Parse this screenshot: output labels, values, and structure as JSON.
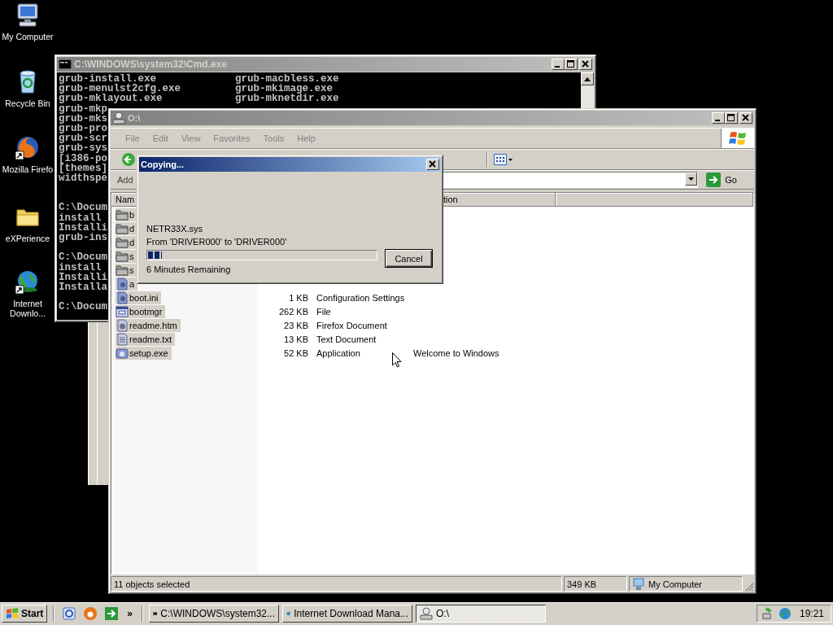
{
  "desktop_icons": [
    {
      "label": "My Computer",
      "kind": "computer",
      "shortcut": false
    },
    {
      "label": "Recycle Bin",
      "kind": "bin",
      "shortcut": false
    },
    {
      "label": "Mozilla Firefo",
      "kind": "browser",
      "shortcut": true
    },
    {
      "label": "eXPerience",
      "kind": "folder",
      "shortcut": false
    },
    {
      "label": "Internet Downlo...",
      "kind": "globe",
      "shortcut": true
    }
  ],
  "console_window": {
    "title": "C:\\WINDOWS\\system32\\Cmd.exe",
    "blocks": [
      [
        {
          "left": "grub-install.exe",
          "right": "grub-macbless.exe"
        },
        {
          "left": "grub-menulst2cfg.exe",
          "right": "grub-mkimage.exe"
        },
        {
          "left": "grub-mklayout.exe",
          "right": "grub-mknetdir.exe"
        },
        {
          "left": "grub-mkp"
        },
        {
          "left": "grub-mks"
        },
        {
          "left": "grub-pro"
        },
        {
          "left": "grub-scr"
        },
        {
          "left": "grub-sys"
        },
        {
          "left": "[i386-po"
        },
        {
          "left": "[themes]"
        },
        {
          "left": "widthspe"
        }
      ],
      [
        {
          "left": "C:\\Docum"
        },
        {
          "left": "install"
        },
        {
          "left": "Installi"
        },
        {
          "left": "grub-ins"
        }
      ],
      [
        {
          "left": "C:\\Docum"
        },
        {
          "left": "install"
        },
        {
          "left": "Installi"
        },
        {
          "left": "Installa"
        }
      ],
      [
        {
          "left": "C:\\Docum"
        }
      ]
    ]
  },
  "explorer_window": {
    "title": "O:\\",
    "menu": [
      "File",
      "Edit",
      "View",
      "Favorites",
      "Tools",
      "Help"
    ],
    "address_label": "Add",
    "go": "Go",
    "columns": [
      "Nam",
      "tion"
    ],
    "files": [
      {
        "name": "b",
        "kind": "folder",
        "selected": true
      },
      {
        "name": "d",
        "kind": "folder",
        "selected": true
      },
      {
        "name": "d",
        "kind": "folder",
        "selected": true
      },
      {
        "name": "s",
        "kind": "folder",
        "selected": true
      },
      {
        "name": "s",
        "kind": "folder",
        "selected": true
      },
      {
        "name": "a",
        "kind": "config",
        "selected": true
      },
      {
        "name": "boot.ini",
        "kind": "config",
        "selected": true,
        "size": "1 KB",
        "type": "Configuration Settings"
      },
      {
        "name": "bootmgr",
        "kind": "system",
        "selected": true,
        "size": "262 KB",
        "type": "File"
      },
      {
        "name": "readme.htm",
        "kind": "web",
        "selected": true,
        "size": "23 KB",
        "type": "Firefox Document"
      },
      {
        "name": "readme.txt",
        "kind": "text",
        "selected": true,
        "size": "13 KB",
        "type": "Text Document"
      },
      {
        "name": "setup.exe",
        "kind": "app",
        "selected": true,
        "size": "52 KB",
        "type": "Application",
        "comment": "Welcome to Windows"
      }
    ],
    "status_bar": [
      "11 objects selected",
      "349 KB",
      "My Computer"
    ]
  },
  "copy_dialog": {
    "title": "Copying...",
    "file": "NETR33X.sys",
    "from_to": "From 'DRIVER000' to 'DRIVER000'",
    "progress": {
      "level": 0.06
    },
    "time_remaining": "6 Minutes Remaining",
    "cancel": "Cancel"
  },
  "taskbar": {
    "start": "Start",
    "more": "»",
    "tasks": [
      {
        "label": "C:\\WINDOWS\\system32...",
        "kind": "console",
        "selected": false
      },
      {
        "label": "Internet Download Mana...",
        "kind": "globe",
        "selected": false
      },
      {
        "label": "O:\\",
        "kind": "drive",
        "selected": true
      }
    ],
    "clock": "19:21"
  }
}
